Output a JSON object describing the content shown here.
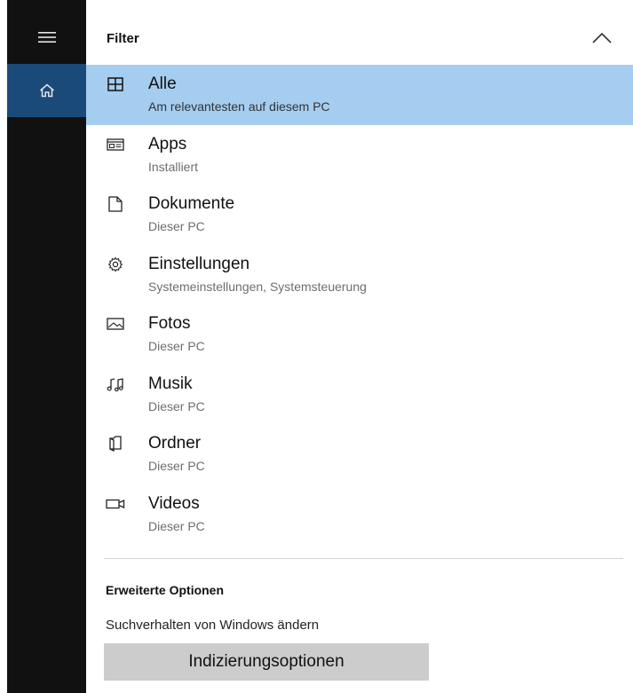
{
  "rail": {
    "menu_icon": "hamburger-menu-icon",
    "home_icon": "home-icon",
    "active_color": "#1a4a78"
  },
  "filter": {
    "title": "Filter",
    "collapse_icon": "chevron-up-icon"
  },
  "items": [
    {
      "title": "Alle",
      "subtitle": "Am relevantesten auf diesem PC",
      "icon": "grid-icon",
      "selected": true
    },
    {
      "title": "Apps",
      "subtitle": "Installiert",
      "icon": "app-window-icon",
      "selected": false
    },
    {
      "title": "Dokumente",
      "subtitle": "Dieser PC",
      "icon": "document-icon",
      "selected": false
    },
    {
      "title": "Einstellungen",
      "subtitle": "Systemeinstellungen, Systemsteuerung",
      "icon": "gear-icon",
      "selected": false
    },
    {
      "title": "Fotos",
      "subtitle": "Dieser PC",
      "icon": "photo-icon",
      "selected": false
    },
    {
      "title": "Musik",
      "subtitle": "Dieser PC",
      "icon": "music-icon",
      "selected": false
    },
    {
      "title": "Ordner",
      "subtitle": "Dieser PC",
      "icon": "folder-icon",
      "selected": false
    },
    {
      "title": "Videos",
      "subtitle": "Dieser PC",
      "icon": "video-icon",
      "selected": false
    }
  ],
  "advanced": {
    "title": "Erweiterte Optionen",
    "link": "Suchverhalten von Windows ändern",
    "button": "Indizierungsoptionen"
  },
  "colors": {
    "selected_bg": "#a5cdef",
    "rail_bg": "#111111",
    "button_bg": "#cccccc"
  }
}
